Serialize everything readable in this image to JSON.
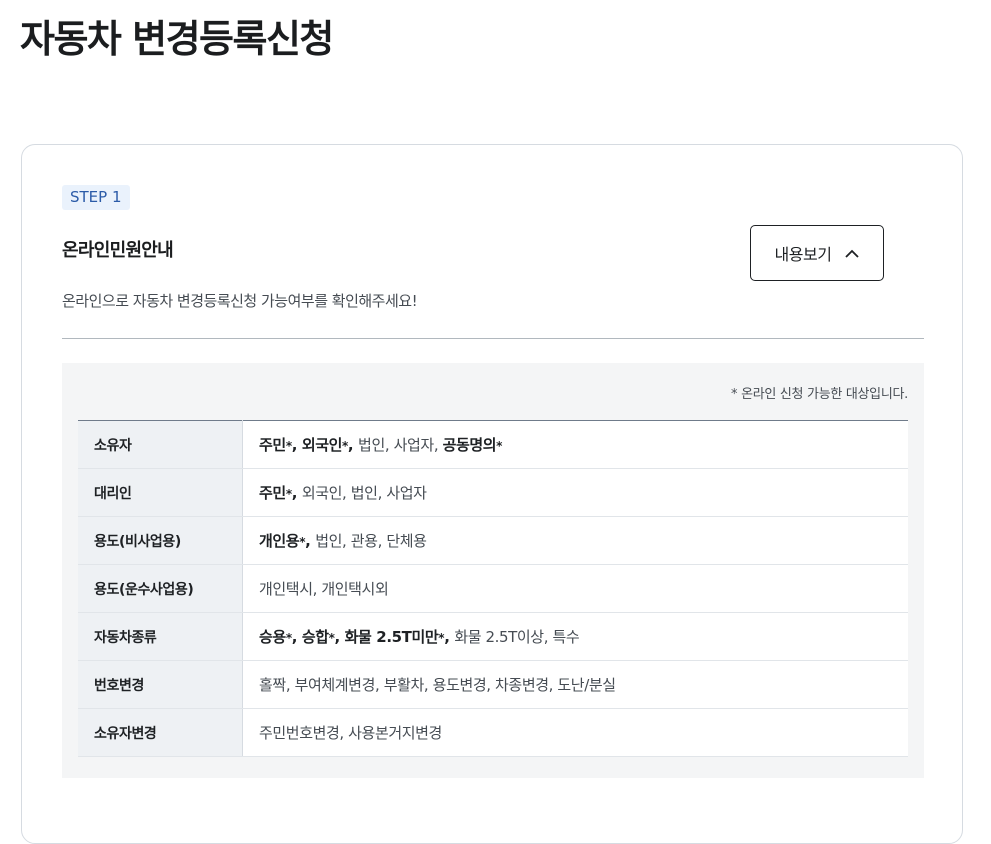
{
  "page": {
    "title": "자동차 변경등록신청"
  },
  "step": {
    "badge": "STEP 1",
    "title": "온라인민원안내",
    "toggle_label": "내용보기",
    "toggle_icon": "chevron-up-icon",
    "description": "온라인으로 자동차 변경등록신청 가능여부를 확인해주세요!"
  },
  "info": {
    "note": "* 온라인 신청 가능한 대상입니다.",
    "rows": [
      {
        "label": "소유자",
        "segments": [
          {
            "text": "주민",
            "bold": true,
            "star": true
          },
          {
            "text": "외국인",
            "bold": true,
            "star": true
          },
          {
            "text": "법인",
            "bold": false,
            "star": false
          },
          {
            "text": "사업자",
            "bold": false,
            "star": false
          },
          {
            "text": "공동명의",
            "bold": true,
            "star": true
          }
        ]
      },
      {
        "label": "대리인",
        "segments": [
          {
            "text": "주민",
            "bold": true,
            "star": true
          },
          {
            "text": "외국인",
            "bold": false,
            "star": false
          },
          {
            "text": "법인",
            "bold": false,
            "star": false
          },
          {
            "text": "사업자",
            "bold": false,
            "star": false
          }
        ]
      },
      {
        "label": "용도(비사업용)",
        "segments": [
          {
            "text": "개인용",
            "bold": true,
            "star": true
          },
          {
            "text": "법인",
            "bold": false,
            "star": false
          },
          {
            "text": "관용",
            "bold": false,
            "star": false
          },
          {
            "text": "단체용",
            "bold": false,
            "star": false
          }
        ]
      },
      {
        "label": "용도(운수사업용)",
        "segments": [
          {
            "text": "개인택시",
            "bold": false,
            "star": false
          },
          {
            "text": "개인택시외",
            "bold": false,
            "star": false
          }
        ]
      },
      {
        "label": "자동차종류",
        "segments": [
          {
            "text": "승용",
            "bold": true,
            "star": true
          },
          {
            "text": "승합",
            "bold": true,
            "star": true
          },
          {
            "text": "화물 2.5T미만",
            "bold": true,
            "star": true
          },
          {
            "text": "화물 2.5T이상",
            "bold": false,
            "star": false
          },
          {
            "text": "특수",
            "bold": false,
            "star": false
          }
        ]
      },
      {
        "label": "번호변경",
        "segments": [
          {
            "text": "홀짝",
            "bold": false,
            "star": false
          },
          {
            "text": "부여체계변경",
            "bold": false,
            "star": false
          },
          {
            "text": "부활차",
            "bold": false,
            "star": false
          },
          {
            "text": "용도변경",
            "bold": false,
            "star": false
          },
          {
            "text": "차종변경",
            "bold": false,
            "star": false
          },
          {
            "text": "도난/분실",
            "bold": false,
            "star": false
          }
        ]
      },
      {
        "label": "소유자변경",
        "segments": [
          {
            "text": "주민번호변경",
            "bold": false,
            "star": false
          },
          {
            "text": "사용본거지변경",
            "bold": false,
            "star": false
          }
        ]
      }
    ]
  }
}
